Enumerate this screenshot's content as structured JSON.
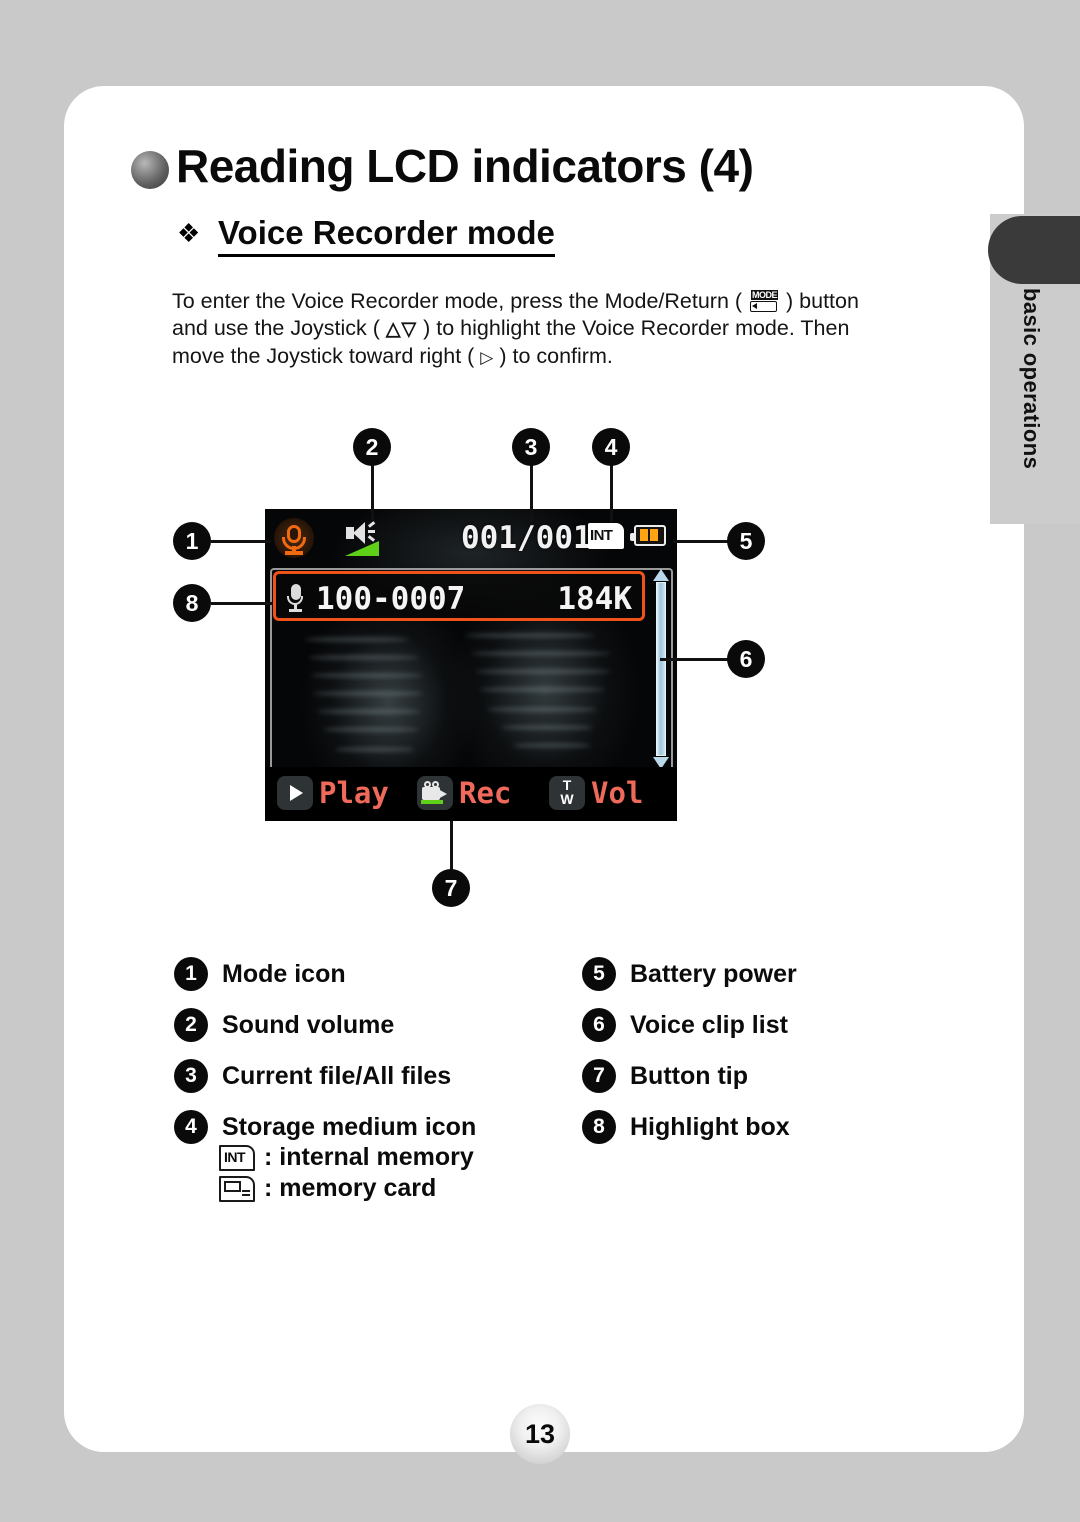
{
  "page": {
    "number": "13",
    "side_tab_label": "basic operations",
    "background_color": "#c9c9c9",
    "card_color": "#ffffff"
  },
  "heading": {
    "bullet_icon": "sphere-bullet-icon",
    "title": "Reading LCD indicators (4)",
    "sub_diamond_icon": "diamond-bullet-icon",
    "subtitle": "Voice Recorder mode"
  },
  "paragraph": {
    "line1_a": "To enter the Voice Recorder mode, press the Mode/Return (",
    "line1_b": ") button",
    "line2_a": "and use the Joystick (",
    "line2_glyph": "△▽",
    "line2_b": ") to highlight the Voice Recorder mode. Then",
    "line3_a": "move the Joystick toward right (",
    "line3_glyph": "▷",
    "line3_b": ") to confirm.",
    "mode_button_label": "MODE"
  },
  "lcd": {
    "status_bar": {
      "mode_icon": "microphone-mode-icon",
      "volume_icon": "speaker-volume-icon",
      "file_count": "001/001",
      "storage_badge": "INT",
      "battery_icon": "battery-icon"
    },
    "highlight_row": {
      "clip_icon": "microphone-icon",
      "clip_name": "100-0007",
      "clip_size": "184K"
    },
    "scrollbar": {
      "up_arrow": "scroll-up-arrow-icon",
      "down_arrow": "scroll-down-arrow-icon"
    },
    "tip_bar": [
      {
        "icon": "play-icon",
        "label": "Play"
      },
      {
        "icon": "camcorder-rec-icon",
        "label": "Rec"
      },
      {
        "icon": "tele-wide-icon",
        "label": "Vol",
        "tele": "T",
        "wide": "W"
      }
    ]
  },
  "callouts": [
    {
      "n": "1"
    },
    {
      "n": "2"
    },
    {
      "n": "3"
    },
    {
      "n": "4"
    },
    {
      "n": "5"
    },
    {
      "n": "6"
    },
    {
      "n": "7"
    },
    {
      "n": "8"
    }
  ],
  "legend": {
    "left": [
      {
        "n": "1",
        "label": "Mode icon"
      },
      {
        "n": "2",
        "label": "Sound volume"
      },
      {
        "n": "3",
        "label": "Current file/All files"
      },
      {
        "n": "4",
        "label": "Storage medium icon"
      }
    ],
    "storage_detail": [
      {
        "icon": "INT",
        "label": ": internal memory"
      },
      {
        "icon": "card",
        "label": ": memory card"
      }
    ],
    "right": [
      {
        "n": "5",
        "label": "Battery power"
      },
      {
        "n": "6",
        "label": "Voice clip list"
      },
      {
        "n": "7",
        "label": "Button tip"
      },
      {
        "n": "8",
        "label": "Highlight box"
      }
    ]
  },
  "colors": {
    "accent_orange": "#f0521a",
    "mic_orange": "#f06a12",
    "tip_salmon": "#ef6a5a",
    "volume_green": "#5ed017",
    "battery_amber": "#ffa412"
  }
}
